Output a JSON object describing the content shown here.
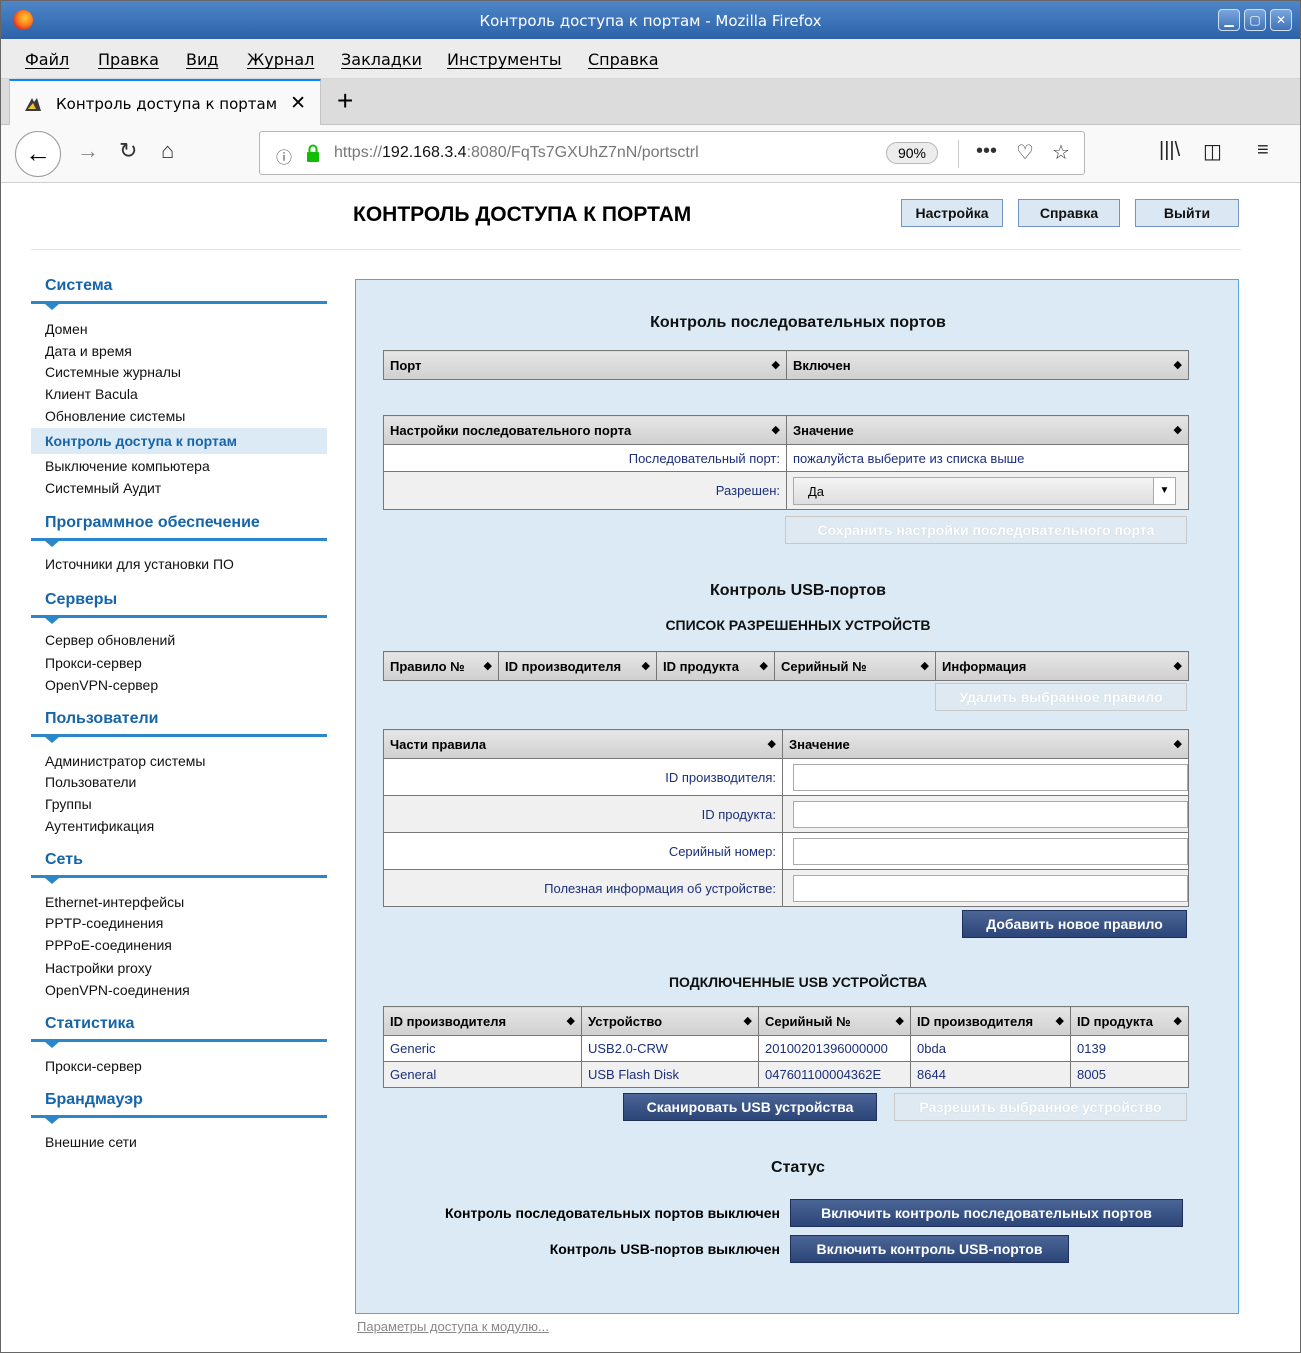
{
  "window": {
    "title": "Контроль доступа к портам - Mozilla Firefox"
  },
  "menu": [
    "Файл",
    "Правка",
    "Вид",
    "Журнал",
    "Закладки",
    "Инструменты",
    "Справка"
  ],
  "tab": {
    "label": "Контроль доступа к портам"
  },
  "nav": {
    "url_prefix": "https://",
    "url_host": "192.168.3.4",
    "url_rest": ":8080/FqTs7GXUhZ7nN/portsctrl",
    "zoom": "90%"
  },
  "header": {
    "title": "КОНТРОЛЬ ДОСТУПА К ПОРТАМ",
    "btn_settings": "Настройка",
    "btn_help": "Справка",
    "btn_logout": "Выйти"
  },
  "sidebar": {
    "sections": [
      {
        "title": "Система",
        "items": [
          "Домен",
          "Дата и время",
          "Системные журналы",
          "Клиент Bacula",
          "Обновление системы",
          "Контроль доступа к портам",
          "Выключение компьютера",
          "Системный Аудит"
        ]
      },
      {
        "title": "Программное обеспечение",
        "items": [
          "Источники для установки ПО"
        ]
      },
      {
        "title": "Серверы",
        "items": [
          "Сервер обновлений",
          "Прокси-сервер",
          "OpenVPN-сервер"
        ]
      },
      {
        "title": "Пользователи",
        "items": [
          "Администратор системы",
          "Пользователи",
          "Группы",
          "Аутентификация"
        ]
      },
      {
        "title": "Сеть",
        "items": [
          "Ethernet-интерфейсы",
          "PPTP-соединения",
          "PPPoE-соединения",
          "Настройки proxy",
          "OpenVPN-соединения"
        ]
      },
      {
        "title": "Статистика",
        "items": [
          "Прокси-сервер"
        ]
      },
      {
        "title": "Брандмауэр",
        "items": [
          "Внешние сети"
        ]
      }
    ],
    "selected": "Контроль доступа к портам"
  },
  "serial": {
    "title": "Контроль последовательных портов",
    "ports_table": {
      "headers": [
        "Порт",
        "Включен"
      ]
    },
    "settings_table": {
      "headers": [
        "Настройки последовательного порта",
        "Значение"
      ],
      "row1_label": "Последовательный порт:",
      "row1_value": "пожалуйста выберите из списка выше",
      "row2_label": "Разрешен:",
      "row2_value": "Да"
    },
    "save_btn": "Сохранить настройки последовательного порта"
  },
  "usb": {
    "title": "Контроль USB-портов",
    "allowed_title": "СПИСОК РАЗРЕШЕННЫХ УСТРОЙСТВ",
    "allowed_headers": [
      "Правило №",
      "ID производителя",
      "ID продукта",
      "Серийный №",
      "Информация"
    ],
    "delete_btn": "Удалить выбранное правило",
    "rule_headers": [
      "Части правила",
      "Значение"
    ],
    "rule_fields": [
      "ID производителя:",
      "ID продукта:",
      "Серийный номер:",
      "Полезная информация об устройстве:"
    ],
    "add_btn": "Добавить новое правило",
    "connected_title": "ПОДКЛЮЧЕННЫЕ USB УСТРОЙСТВА",
    "connected_headers": [
      "ID производителя",
      "Устройство",
      "Серийный №",
      "ID производителя",
      "ID продукта"
    ],
    "connected_rows": [
      [
        "Generic",
        "USB2.0-CRW",
        "20100201396000000",
        "0bda",
        "0139"
      ],
      [
        "General",
        "USB Flash Disk",
        "047601100004362E",
        "8644",
        "8005"
      ]
    ],
    "scan_btn": "Сканировать USB устройства",
    "allow_btn": "Разрешить выбранное устройство"
  },
  "status": {
    "title": "Статус",
    "serial_text": "Контроль последовательных портов выключен",
    "serial_btn": "Включить контроль последовательных портов",
    "usb_text": "Контроль USB-портов выключен",
    "usb_btn": "Включить контроль USB-портов"
  },
  "footer": {
    "link": "Параметры доступа к модулю..."
  }
}
